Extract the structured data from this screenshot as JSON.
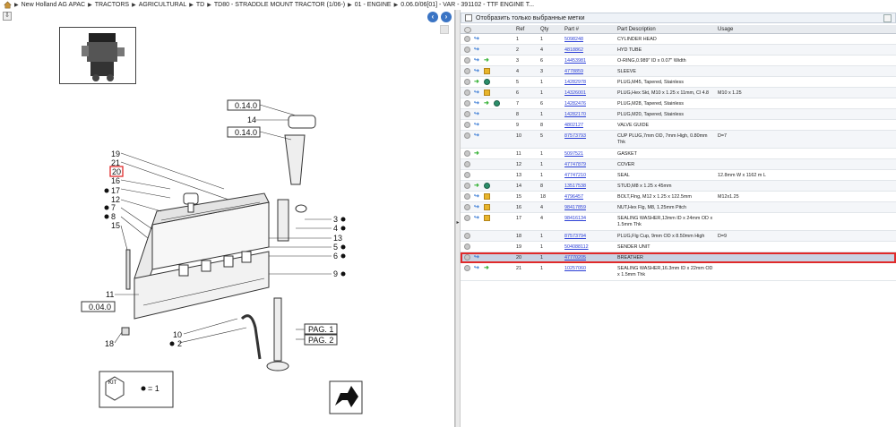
{
  "breadcrumb": {
    "items": [
      "New Holland AG APAC",
      "TRACTORS",
      "AGRICULTURAL",
      "TD",
      "TD80 - STRADDLE MOUNT TRACTOR (1/06-)",
      "01 - ENGINE",
      "0.06.0/06[01] - VAR - 391102 - TTF ENGINE T..."
    ]
  },
  "drawing": {
    "refs_left": [
      "19",
      "21",
      "20",
      "16",
      "17",
      "12",
      "7",
      "8",
      "15",
      "11",
      "10",
      "18",
      "2"
    ],
    "refs_right": [
      "14",
      "3",
      "4",
      "13",
      "5",
      "6",
      "9"
    ],
    "boxes": [
      "0.14.0",
      "0.14.0",
      "0.04.0"
    ],
    "pag": [
      "PAG. 1",
      "PAG. 2"
    ],
    "kit_label": "KIT",
    "kit_legend": "= 1"
  },
  "filter": {
    "label": "Отобразить только выбранные метки"
  },
  "table": {
    "headers": [
      "Ref",
      "Qty",
      "Part #",
      "Part Description",
      "Usage"
    ],
    "rows": [
      {
        "ref": "1",
        "qty": "1",
        "part": "5098248",
        "desc": "CYLINDER HEAD",
        "usage": "",
        "icons": [
          "arrow"
        ]
      },
      {
        "ref": "2",
        "qty": "4",
        "part": "4818862",
        "desc": "HYD TUBE",
        "usage": "",
        "icons": [
          "arrow"
        ]
      },
      {
        "ref": "3",
        "qty": "6",
        "part": "14453981",
        "desc": "O-RING,0.989\" ID x 0.07\" Width",
        "usage": "",
        "icons": [
          "arrow",
          "green"
        ]
      },
      {
        "ref": "4",
        "qty": "3",
        "part": "4778859",
        "desc": "SLEEVE",
        "usage": "",
        "icons": [
          "arrow",
          "box"
        ]
      },
      {
        "ref": "5",
        "qty": "1",
        "part": "14282978",
        "desc": "PLUG,M45, Tapered, Stainless",
        "usage": "",
        "icons": [
          "green",
          "globe"
        ]
      },
      {
        "ref": "6",
        "qty": "1",
        "part": "14326001",
        "desc": "PLUG,Hex Skt, M10 x 1.25 x 11mm, Cl 4.8",
        "usage": "M10 x 1.25",
        "icons": [
          "arrow",
          "box"
        ]
      },
      {
        "ref": "7",
        "qty": "6",
        "part": "14282476",
        "desc": "PLUG,M28, Tapered, Stainless",
        "usage": "",
        "icons": [
          "arrow",
          "green",
          "globe"
        ]
      },
      {
        "ref": "8",
        "qty": "1",
        "part": "14282170",
        "desc": "PLUG,M20, Tapered, Stainless",
        "usage": "",
        "icons": [
          "arrow"
        ]
      },
      {
        "ref": "9",
        "qty": "8",
        "part": "4802127",
        "desc": "VALVE GUIDE",
        "usage": "",
        "icons": [
          "arrow"
        ]
      },
      {
        "ref": "10",
        "qty": "5",
        "part": "87573793",
        "desc": "CUP PLUG,7mm OD, 7mm High, 0.80mm Thk",
        "usage": "D=7",
        "icons": [
          "arrow"
        ]
      },
      {
        "ref": "11",
        "qty": "1",
        "part": "5097521",
        "desc": "GASKET",
        "usage": "",
        "icons": [
          "green"
        ]
      },
      {
        "ref": "12",
        "qty": "1",
        "part": "47747879",
        "desc": "COVER",
        "usage": "",
        "icons": []
      },
      {
        "ref": "13",
        "qty": "1",
        "part": "47747210",
        "desc": "SEAL",
        "usage": "12.8mm W x 1162 m L",
        "icons": []
      },
      {
        "ref": "14",
        "qty": "8",
        "part": "13517538",
        "desc": "STUD,M8 x 1.25 x 45mm",
        "usage": "",
        "icons": [
          "green",
          "globe"
        ]
      },
      {
        "ref": "15",
        "qty": "18",
        "part": "4796457",
        "desc": "BOLT,Flng, M12 x 1.25 x 122.5mm",
        "usage": "M12x1.25",
        "icons": [
          "arrow",
          "box"
        ]
      },
      {
        "ref": "16",
        "qty": "4",
        "part": "98417859",
        "desc": "NUT,Hex Flg, M8, 1.25mm Pitch",
        "usage": "",
        "icons": [
          "arrow",
          "box"
        ]
      },
      {
        "ref": "17",
        "qty": "4",
        "part": "98416134",
        "desc": "SEALING WASHER,13mm ID x 24mm OD x 1.5mm Thk",
        "usage": "",
        "icons": [
          "arrow",
          "box"
        ]
      },
      {
        "ref": "18",
        "qty": "1",
        "part": "87573794",
        "desc": "PLUG,Flg Cup, 9mm OD x 8.50mm High",
        "usage": "D=9",
        "icons": []
      },
      {
        "ref": "19",
        "qty": "1",
        "part": "504088112",
        "desc": "SENDER UNIT",
        "usage": "",
        "icons": []
      },
      {
        "ref": "20",
        "qty": "1",
        "part": "47770205",
        "desc": "BREATHER",
        "usage": "",
        "icons": [
          "arrow"
        ],
        "selected": true
      },
      {
        "ref": "21",
        "qty": "1",
        "part": "10257060",
        "desc": "SEALING WASHER,16.3mm ID x 22mm OD x 1.5mm Thk",
        "usage": "",
        "icons": [
          "arrow",
          "green"
        ]
      }
    ]
  },
  "colors": {
    "selected_outline": "#e02a2a",
    "link": "#2b3fd6",
    "nav_button": "#3a74c4"
  }
}
